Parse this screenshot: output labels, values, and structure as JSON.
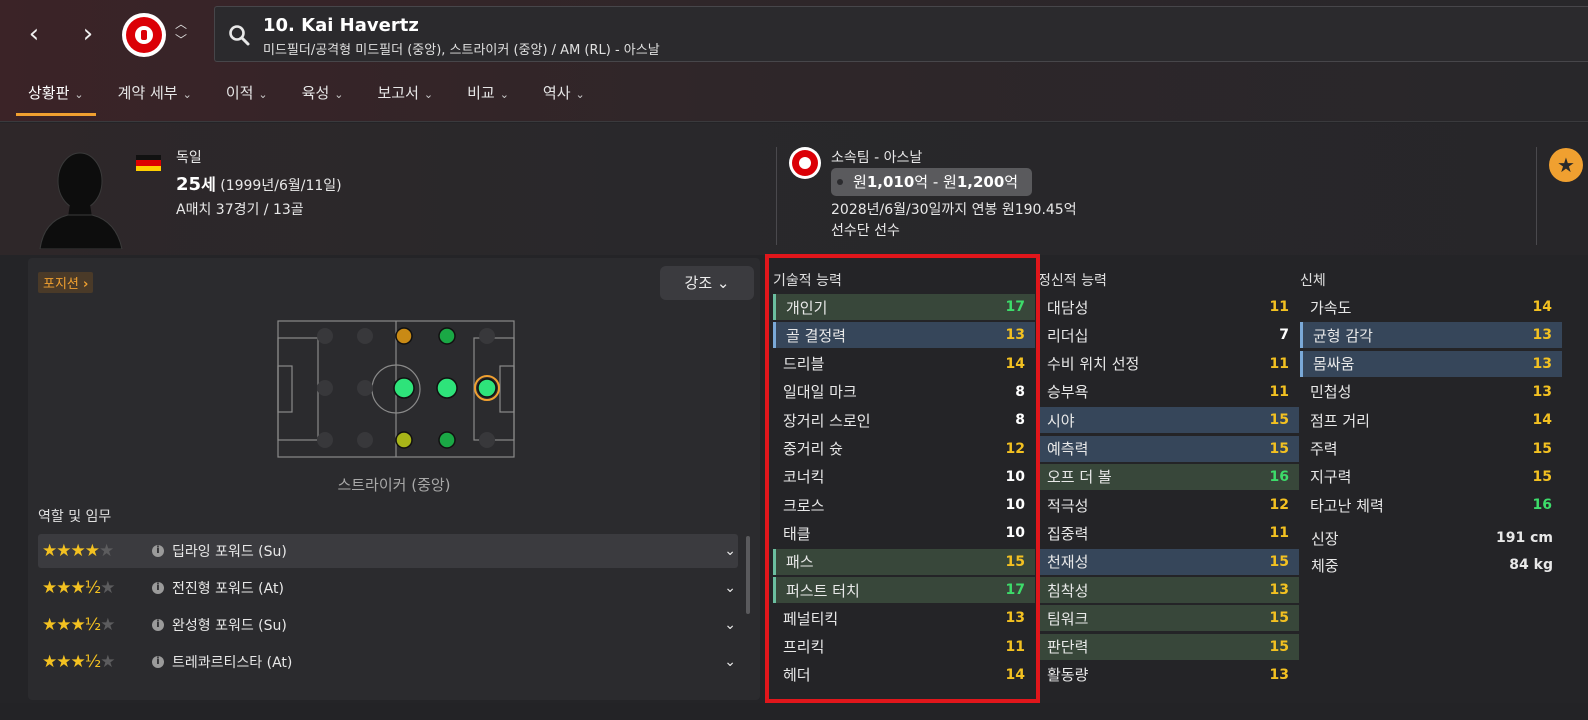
{
  "player": {
    "title": "10. Kai Havertz",
    "subtitle": "미드필더/공격형 미드필더 (중앙), 스트라이커 (중앙) / AM (RL) - 아스날",
    "nationality": "독일",
    "age_num": "25",
    "age_suffix": "세",
    "birth": "(1999년/6월/11일)",
    "caps": "A매치 37경기 / 13골"
  },
  "tabs": [
    {
      "label": "상황판"
    },
    {
      "label": "계약 세부"
    },
    {
      "label": "이적"
    },
    {
      "label": "육성"
    },
    {
      "label": "보고서"
    },
    {
      "label": "비교"
    },
    {
      "label": "역사"
    }
  ],
  "club": {
    "label": "소속팀 - 아스날",
    "value_prefix1": "원",
    "value_b1": "1,010",
    "value_mid": "억 - 원",
    "value_b2": "1,200",
    "value_suffix": "억",
    "contract": "2028년/6월/30일까지 연봉 원190.45억",
    "squad": "선수단 선수"
  },
  "positions_panel": {
    "tag": "포지션",
    "highlight": "강조",
    "position_label": "스트라이커 (중앙)",
    "roles_title": "역할 및 임무"
  },
  "roles": [
    {
      "stars": "★★★★",
      "empty": "★",
      "name": "딥라잉 포워드 (Su)"
    },
    {
      "stars": "★★★½",
      "empty": "★",
      "name": "전진형 포워드 (At)"
    },
    {
      "stars": "★★★½",
      "empty": "★",
      "name": "완성형 포워드 (Su)"
    },
    {
      "stars": "★★★½",
      "empty": "★",
      "name": "트레콰르티스타 (At)"
    }
  ],
  "technical": {
    "title": "기술적 능력",
    "items": [
      {
        "name": "개인기",
        "value": "17"
      },
      {
        "name": "골 결정력",
        "value": "13"
      },
      {
        "name": "드리블",
        "value": "14"
      },
      {
        "name": "일대일 마크",
        "value": "8"
      },
      {
        "name": "장거리 스로인",
        "value": "8"
      },
      {
        "name": "중거리 슛",
        "value": "12"
      },
      {
        "name": "코너킥",
        "value": "10"
      },
      {
        "name": "크로스",
        "value": "10"
      },
      {
        "name": "태클",
        "value": "10"
      },
      {
        "name": "패스",
        "value": "15"
      },
      {
        "name": "퍼스트 터치",
        "value": "17"
      },
      {
        "name": "페널티킥",
        "value": "13"
      },
      {
        "name": "프리킥",
        "value": "11"
      },
      {
        "name": "헤더",
        "value": "14"
      }
    ]
  },
  "mental": {
    "title": "정신적 능력",
    "items": [
      {
        "name": "대담성",
        "value": "11"
      },
      {
        "name": "리더십",
        "value": "7"
      },
      {
        "name": "수비 위치 선정",
        "value": "11"
      },
      {
        "name": "승부욕",
        "value": "11"
      },
      {
        "name": "시야",
        "value": "15"
      },
      {
        "name": "예측력",
        "value": "15"
      },
      {
        "name": "오프 더 볼",
        "value": "16"
      },
      {
        "name": "적극성",
        "value": "12"
      },
      {
        "name": "집중력",
        "value": "11"
      },
      {
        "name": "천재성",
        "value": "15"
      },
      {
        "name": "침착성",
        "value": "13"
      },
      {
        "name": "팀워크",
        "value": "15"
      },
      {
        "name": "판단력",
        "value": "15"
      },
      {
        "name": "활동량",
        "value": "13"
      }
    ]
  },
  "physical": {
    "title": "신체",
    "items": [
      {
        "name": "가속도",
        "value": "14"
      },
      {
        "name": "균형 감각",
        "value": "13"
      },
      {
        "name": "몸싸움",
        "value": "13"
      },
      {
        "name": "민첩성",
        "value": "13"
      },
      {
        "name": "점프 거리",
        "value": "14"
      },
      {
        "name": "주력",
        "value": "15"
      },
      {
        "name": "지구력",
        "value": "15"
      },
      {
        "name": "타고난 체력",
        "value": "16"
      }
    ],
    "height_label": "신장",
    "height": "191 cm",
    "weight_label": "체중",
    "weight": "84 kg"
  },
  "colors": {
    "yellow": "#f3c121",
    "white": "#ffffff",
    "green": "#3ddc6a",
    "accent": "#f0a030",
    "highlight_red": "#e0161b"
  }
}
